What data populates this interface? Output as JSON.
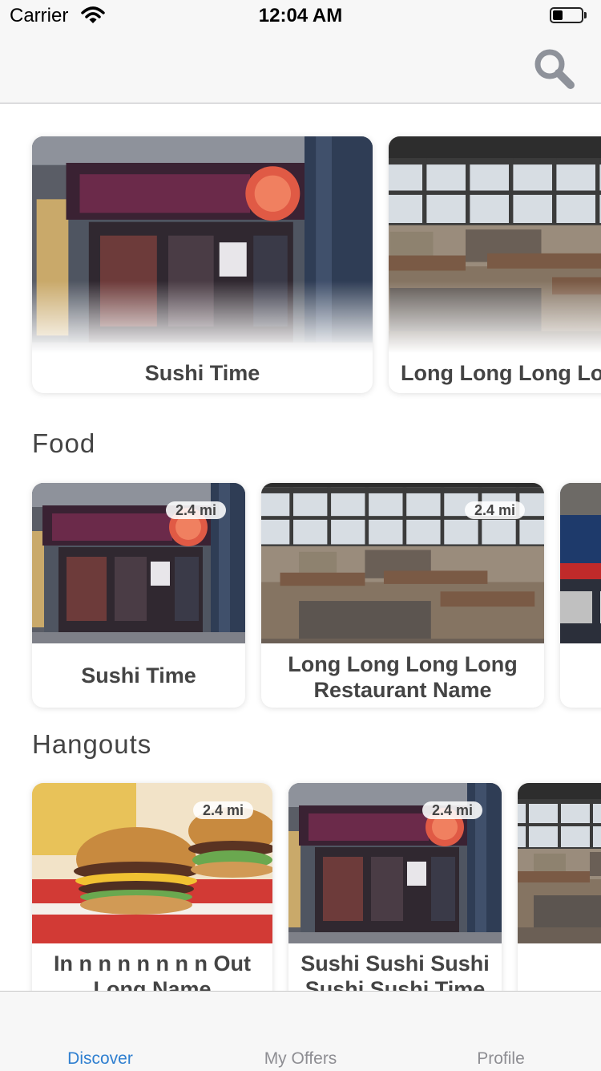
{
  "status_bar": {
    "carrier": "Carrier",
    "time": "12:04 AM",
    "battery_level": 0.35
  },
  "nav_bar": {
    "search_icon": "search-icon"
  },
  "featured": [
    {
      "title": "Sushi Time",
      "image": "sushi-storefront"
    },
    {
      "title": "Long Long Long Long Restaurant Name",
      "image": "restaurant-interior"
    }
  ],
  "sections": [
    {
      "title": "Food",
      "items": [
        {
          "title": "Sushi Time",
          "distance": "2.4 mi",
          "image": "sushi-storefront"
        },
        {
          "title": "Long Long Long Long Restaurant Name",
          "distance": "2.4 mi",
          "image": "restaurant-interior"
        },
        {
          "title": "",
          "distance": "",
          "image": "arcade-interior"
        }
      ]
    },
    {
      "title": "Hangouts",
      "items": [
        {
          "title": "In n n n n n n n Out Long Name",
          "distance": "2.4 mi",
          "image": "burgers-and-fries"
        },
        {
          "title": "Sushi Sushi Sushi Sushi Sushi Time",
          "distance": "2.4 mi",
          "image": "sushi-storefront"
        },
        {
          "title": "",
          "distance": "",
          "image": "restaurant-interior"
        }
      ]
    }
  ],
  "tab_bar": {
    "tabs": [
      {
        "label": "Discover",
        "active": true
      },
      {
        "label": "My Offers",
        "active": false
      },
      {
        "label": "Profile",
        "active": false
      }
    ],
    "active_color": "#2f7fd0",
    "inactive_color": "#8e8e93"
  }
}
